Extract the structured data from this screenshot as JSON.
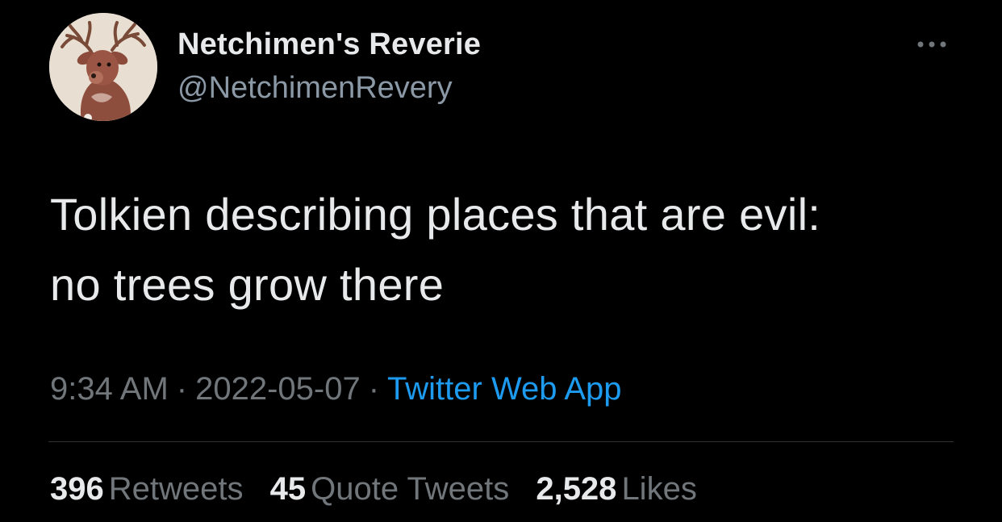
{
  "tweet": {
    "author": {
      "display_name": "Netchimen's Reverie",
      "handle": "@NetchimenRevery",
      "avatar_icon": "deer-avatar"
    },
    "text_lines": [
      "Tolkien describing places that are evil:",
      "no trees grow there"
    ],
    "time": "9:34 AM",
    "date": "2022-05-07",
    "separator": "·",
    "source": "Twitter Web App",
    "stats": {
      "retweets": {
        "count": "396",
        "label": "Retweets"
      },
      "quote_tweets": {
        "count": "45",
        "label": "Quote Tweets"
      },
      "likes": {
        "count": "2,528",
        "label": "Likes"
      }
    }
  },
  "colors": {
    "background": "#000000",
    "primary_text": "#e7e9ea",
    "secondary_text": "#71767b",
    "link": "#1d9bf0",
    "divider": "#2f3336"
  },
  "icons": {
    "more": "more-horizontal-icon"
  }
}
